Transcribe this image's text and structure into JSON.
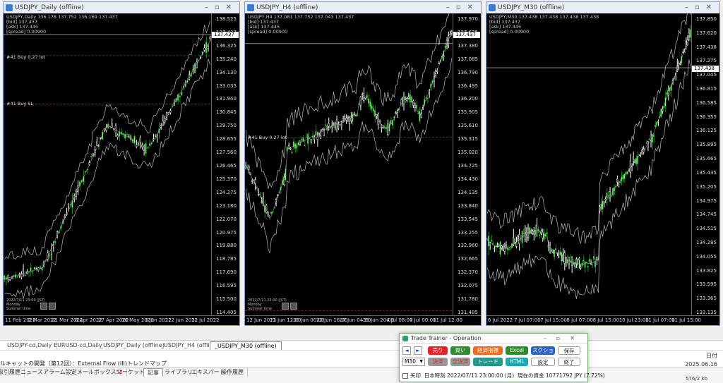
{
  "charts": [
    {
      "id": "c1",
      "title": "USDJPY_Daily (offline)",
      "info": [
        "USDJPY,Daily  136.178 137.752 136.169 137.437",
        "[bid] 137.437",
        "[ask] 137.445",
        "[spread] 0.00900"
      ],
      "price_tag": "137.437",
      "price_ticks": [
        "138.525",
        "137.437",
        "136.325",
        "135.240",
        "134.130",
        "133.035",
        "131.940",
        "130.845",
        "129.750",
        "128.655",
        "127.560",
        "126.465",
        "125.370",
        "124.275",
        "123.180",
        "122.070",
        "120.975",
        "119.880",
        "118.785",
        "117.690",
        "116.595",
        "115.500",
        "114.405"
      ],
      "time_ticks": [
        "11 Feb 2022",
        "2 Mar 2022",
        "21 Mar 2022",
        "8 Apr 2022",
        "27 Apr 2022",
        "16 May 2022",
        "3 Jun 2022",
        "22 Jun 2022",
        "11 Jul 2022"
      ],
      "levels": [
        "#41 Buy 0.27 lot",
        "#41 Buy SL"
      ],
      "widget": [
        "2022/7/11 23:00 (JST)",
        "Monday",
        "Summer time"
      ]
    },
    {
      "id": "c2",
      "title": "USDJPY_H4 (offline)",
      "info": [
        "USDJPY,H4  137.081 137.752 137.043 137.437",
        "[bid] 137.437",
        "[ask] 137.445",
        "[spread] 0.00900"
      ],
      "price_tag": "137.437",
      "price_ticks": [
        "137.970",
        "137.675",
        "137.380",
        "137.085",
        "136.790",
        "136.495",
        "136.200",
        "135.905",
        "135.610",
        "135.315",
        "135.020",
        "134.725",
        "134.430",
        "134.135",
        "133.840",
        "133.545",
        "133.255",
        "132.960",
        "132.665",
        "132.370",
        "132.075",
        "131.780",
        "131.485"
      ],
      "time_ticks": [
        "12 Jun 2022",
        "13 Jun 12:00",
        "20 Jun 00:00",
        "22 Jun 16:00",
        "27 Jun 04:00",
        "29 Jun 20:00",
        "4 Jul 08:00",
        "7 Jul 00:00",
        "11 Jul 12:00"
      ],
      "levels": [
        "#41 Buy 0.27 lot"
      ],
      "widget": [
        "2022/7/11 23:00 (JST)",
        "Monday",
        "Summer time"
      ]
    },
    {
      "id": "c3",
      "title": "USDJPY_M30 (offline)",
      "info": [
        "USDJPY,M30  137.438 137.438 137.438 137.438",
        "[bid] 137.437",
        "[ask] 137.445",
        "[spread] 0.00900"
      ],
      "price_tag": "137.438",
      "price_ticks": [
        "137.850",
        "137.620",
        "137.438",
        "137.275",
        "137.045",
        "136.815",
        "136.585",
        "136.355",
        "136.125",
        "135.895",
        "135.665",
        "135.435",
        "135.205",
        "134.975",
        "134.745",
        "134.515",
        "134.285",
        "134.055",
        "133.825",
        "133.595",
        "133.365",
        "133.135"
      ],
      "time_ticks": [
        "6 Jul 2022",
        "7 Jul 07:00",
        "7 Jul 15:00",
        "8 Jul 07:00",
        "8 Jul 15:00",
        "10 Jul 23:00",
        "11 Jul 07:00",
        "11 Jul 15:00"
      ],
      "levels": [],
      "widget": [
        "2022/7/11 23:00 (JST)",
        "Monday",
        "Summer time"
      ]
    }
  ],
  "chart_tabs": [
    "USDJPY-cd,Daily",
    "EURUSD-cd,Daily",
    "_USDJPY_Daily (offline)",
    "_USDJPY_H4 (offline)",
    "_USDJPY_M30 (offline)"
  ],
  "chart_tabs_active": 4,
  "news_line": "ルキャットの開発（第12回）：External Flow (III)トレンドマップ",
  "right_header": "日付",
  "right_date": "2025.06.16",
  "toolbox_tabs": [
    {
      "label": "取引履歴",
      "badge": ""
    },
    {
      "label": "ニュース",
      "badge": ""
    },
    {
      "label": "アラーム設定",
      "badge": ""
    },
    {
      "label": "メールボックス",
      "badge": "52"
    },
    {
      "label": "マーケット",
      "badge": "90"
    },
    {
      "label": "記事",
      "badge": ""
    },
    {
      "label": "ライブラリ",
      "badge": ""
    },
    {
      "label": "エキスパート",
      "badge": ""
    },
    {
      "label": "操作履歴",
      "badge": ""
    }
  ],
  "toolbox_active": 5,
  "status_text": "576/2 kb",
  "trader": {
    "title": "Trade Trainer - Operation",
    "prev": "◄",
    "next": "►",
    "sell": "売り",
    "buy": "買い",
    "indicator": "経済指標",
    "excel": "Excel",
    "screenshot": "スクショ",
    "save": "保存",
    "timeframe": "M30",
    "close": "決済",
    "close_all": "全決済",
    "trade": "トレード",
    "html": "HTML",
    "settings": "設定",
    "exit": "終了",
    "arrow_label": "矢印",
    "time_info": "日本時刻 2022/07/11 23:00:00 (月)",
    "balance_info": "現在の資金 10771792 JPY (7.72%)"
  },
  "colors": {
    "bull": "#1f8a1f",
    "bull_light": "#7cff7c",
    "bear": "#ffffff",
    "band": "#bbbbbb",
    "sell_btn": "#e12424",
    "buy_btn": "#2e8b2e",
    "indicator_btn": "#f06a1f",
    "excel_btn": "#2e8b2e",
    "screenshot_btn": "#2a62c9",
    "trade_btn": "#1e9c8b",
    "html_btn": "#18a9b5"
  }
}
